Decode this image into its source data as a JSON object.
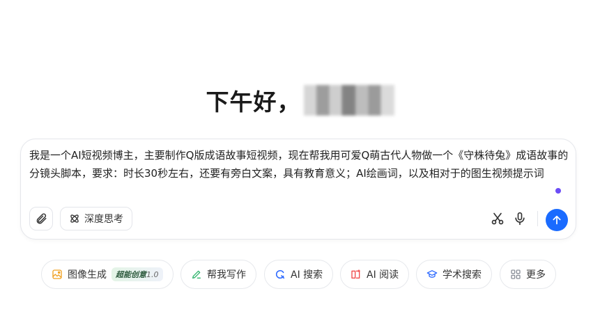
{
  "greeting": "下午好，",
  "composer": {
    "prompt": "我是一个AI短视频博主，主要制作Q版成语故事短视频，现在帮我用可爱Q萌古代人物做一个《守株待兔》成语故事的分镜头脚本，要求：时长30秒左右，还要有旁白文案，具有教育意义；AI绘画词，以及相对于的图生视频提示词",
    "deep_think_label": "深度思考",
    "icons": {
      "attach": "paperclip-icon",
      "deep_think": "atom-icon",
      "cut": "scissors-icon",
      "voice": "microphone-icon",
      "send": "arrow-up-icon"
    },
    "accent": "#1a6bff"
  },
  "quick_actions": [
    {
      "label": "图像生成",
      "icon": "image-icon",
      "color": "#f0a020",
      "badge": "超能创意",
      "badge_version": "1.0"
    },
    {
      "label": "帮我写作",
      "icon": "pen-icon",
      "color": "#2fb36b"
    },
    {
      "label": "AI 搜索",
      "icon": "search-icon",
      "color": "#2f6bff"
    },
    {
      "label": "AI 阅读",
      "icon": "book-icon",
      "color": "#f04a4a"
    },
    {
      "label": "学术搜索",
      "icon": "graduation-cap-icon",
      "color": "#2f6bff"
    },
    {
      "label": "更多",
      "icon": "grid-icon",
      "color": "#8a8f99"
    }
  ]
}
